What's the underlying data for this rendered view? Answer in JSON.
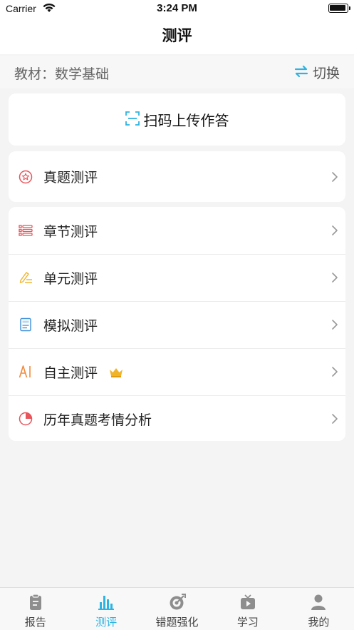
{
  "status_bar": {
    "carrier": "Carrier",
    "time": "3:24 PM"
  },
  "nav": {
    "title": "测评"
  },
  "textbook": {
    "label": "教材：数学基础",
    "switch_label": "切换"
  },
  "scan": {
    "label": "扫码上传作答"
  },
  "real_exam": {
    "label": "真题测评",
    "icon": "star-circle-icon"
  },
  "menu": [
    {
      "label": "章节测评",
      "icon": "list-icon"
    },
    {
      "label": "单元测评",
      "icon": "pencil-lines-icon"
    },
    {
      "label": "模拟测评",
      "icon": "document-icon"
    },
    {
      "label": "自主测评",
      "icon": "ai-icon",
      "badge": "crown-icon"
    },
    {
      "label": "历年真题考情分析",
      "icon": "pie-chart-icon"
    }
  ],
  "tabs": [
    {
      "label": "报告",
      "icon": "clipboard-icon",
      "active": false
    },
    {
      "label": "测评",
      "icon": "bar-chart-icon",
      "active": true
    },
    {
      "label": "错题强化",
      "icon": "target-icon",
      "active": false
    },
    {
      "label": "学习",
      "icon": "tv-play-icon",
      "active": false
    },
    {
      "label": "我的",
      "icon": "user-icon",
      "active": false
    }
  ],
  "colors": {
    "accent": "#2db4e2",
    "red_icon": "#e8545a",
    "gold_icon": "#f0b429",
    "blue_icon": "#3d8fd8",
    "orange_icon": "#f08a3c",
    "tab_inactive": "#8e8e8e"
  }
}
